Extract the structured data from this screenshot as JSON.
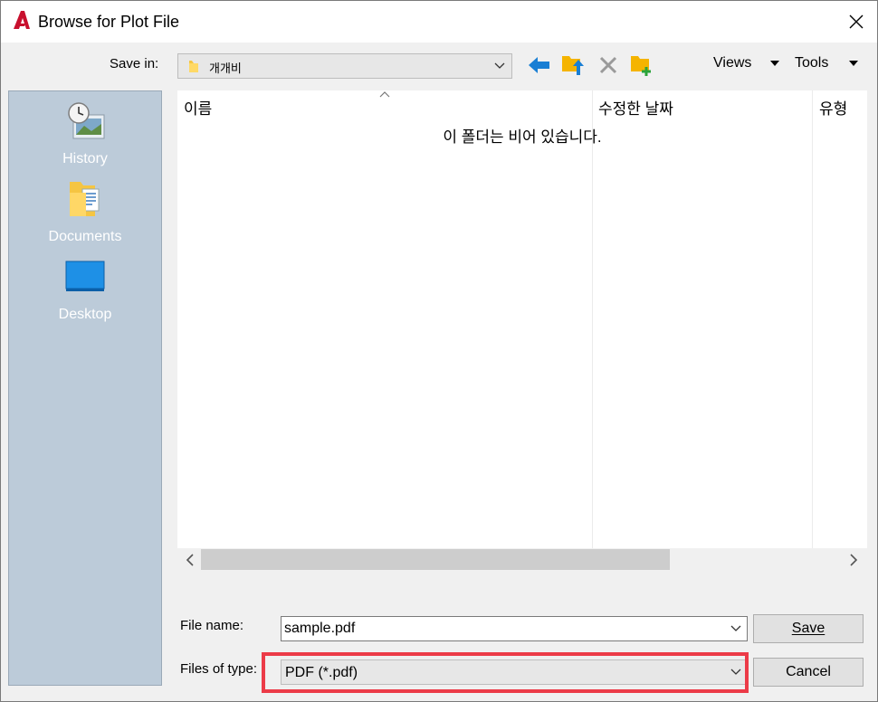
{
  "window": {
    "title": "Browse for Plot File"
  },
  "toolbar": {
    "save_in_label": "Save in:",
    "save_in_value": "개개비",
    "views_label": "Views",
    "tools_label": "Tools"
  },
  "places": [
    {
      "label": "History",
      "icon": "history-icon"
    },
    {
      "label": "Documents",
      "icon": "documents-icon"
    },
    {
      "label": "Desktop",
      "icon": "desktop-icon"
    }
  ],
  "file_list": {
    "columns": [
      "이름",
      "수정한 날짜",
      "유형"
    ],
    "empty_message": "이 폴더는 비어 있습니다."
  },
  "form": {
    "file_name_label": "File name:",
    "file_name_value": "sample.pdf",
    "files_of_type_label": "Files of type:",
    "files_of_type_value": "PDF (*.pdf)",
    "save_label": "Save",
    "cancel_label": "Cancel"
  },
  "colors": {
    "highlight": "#ec3b48",
    "places_bg": "#bccbd9",
    "accent_blue": "#1a7fd4",
    "folder_yellow": "#f5b400"
  }
}
